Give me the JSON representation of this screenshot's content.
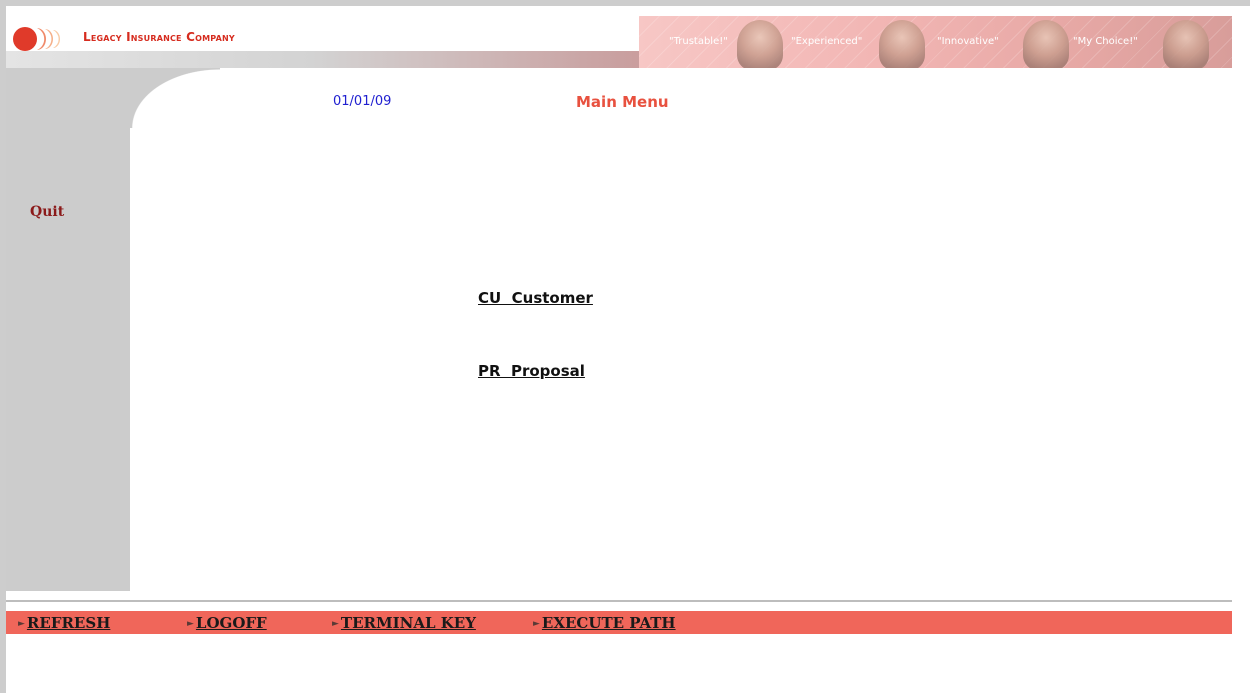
{
  "header": {
    "company_name": "Legacy Insurance Company",
    "slogans": [
      "\"Trustable!\"",
      "\"Experienced\"",
      "\"Innovative\"",
      "\"My Choice!\""
    ]
  },
  "sidebar": {
    "quit_label": "Quit"
  },
  "main": {
    "date": "01/01/09",
    "title": "Main Menu",
    "menu_items": [
      "CU  Customer",
      "PR  Proposal"
    ]
  },
  "footer": {
    "actions": [
      "REFRESH",
      "LOGOFF",
      "TERMINAL KEY",
      "EXECUTE PATH"
    ]
  },
  "colors": {
    "accent": "#f0665a",
    "title": "#e8513f",
    "date": "#2020d0",
    "logo_red": "#d62c1f",
    "sidebar": "#cccccc"
  },
  "icons": {
    "logo": "logo-icon",
    "action_arrow": "triangle-right-icon"
  }
}
